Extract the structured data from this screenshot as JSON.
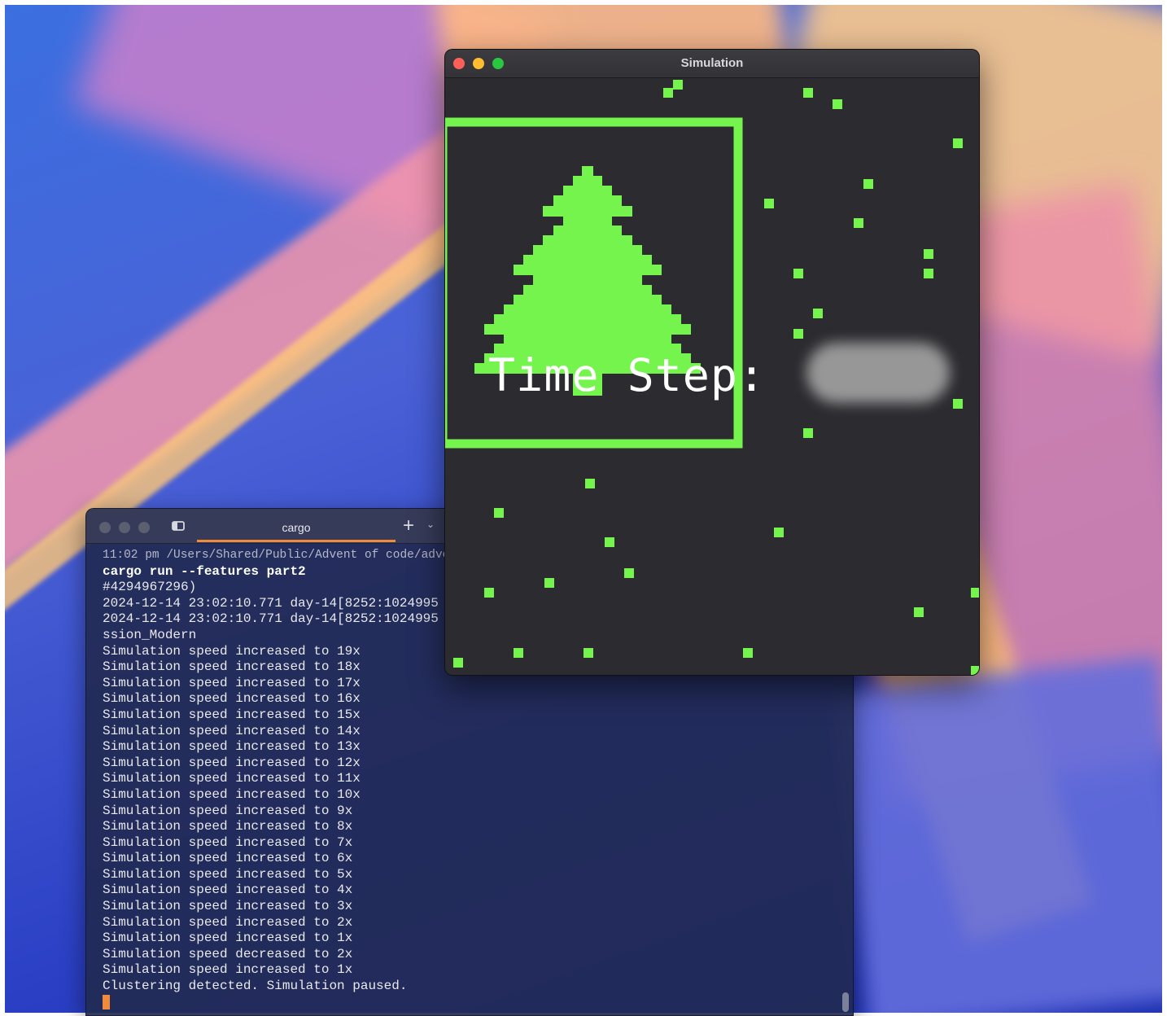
{
  "colors": {
    "robot_green": "#76f44e",
    "sim_background": "#2c2c30",
    "terminal_tab_accent": "#f08a3c"
  },
  "simulation_window": {
    "title": "Simulation",
    "overlay_label": "Time Step:",
    "overlay_value_hidden": true,
    "icons": [
      "close-icon",
      "minimize-icon",
      "zoom-icon"
    ]
  },
  "terminal_window": {
    "tab_title": "cargo",
    "icons": [
      "sidebar-icon",
      "plus-icon",
      "chevron-down-icon"
    ],
    "lines": [
      {
        "kind": "path",
        "text": "11:02 pm /Users/Shared/Public/Advent of code/adve"
      },
      {
        "kind": "cmd",
        "text": "cargo run --features part2"
      },
      {
        "kind": "out",
        "text": "#4294967296)"
      },
      {
        "kind": "out",
        "text": "2024-12-14 23:02:10.771 day-14[8252:1024995"
      },
      {
        "kind": "out",
        "text": "2024-12-14 23:02:10.771 day-14[8252:1024995"
      },
      {
        "kind": "out",
        "text": "ssion_Modern"
      },
      {
        "kind": "out",
        "text": "Simulation speed increased to 19x"
      },
      {
        "kind": "out",
        "text": "Simulation speed increased to 18x"
      },
      {
        "kind": "out",
        "text": "Simulation speed increased to 17x"
      },
      {
        "kind": "out",
        "text": "Simulation speed increased to 16x"
      },
      {
        "kind": "out",
        "text": "Simulation speed increased to 15x"
      },
      {
        "kind": "out",
        "text": "Simulation speed increased to 14x"
      },
      {
        "kind": "out",
        "text": "Simulation speed increased to 13x"
      },
      {
        "kind": "out",
        "text": "Simulation speed increased to 12x"
      },
      {
        "kind": "out",
        "text": "Simulation speed increased to 11x"
      },
      {
        "kind": "out",
        "text": "Simulation speed increased to 10x"
      },
      {
        "kind": "out",
        "text": "Simulation speed increased to 9x"
      },
      {
        "kind": "out",
        "text": "Simulation speed increased to 8x"
      },
      {
        "kind": "out",
        "text": "Simulation speed increased to 7x"
      },
      {
        "kind": "out",
        "text": "Simulation speed increased to 6x"
      },
      {
        "kind": "out",
        "text": "Simulation speed increased to 5x"
      },
      {
        "kind": "out",
        "text": "Simulation speed increased to 4x"
      },
      {
        "kind": "out",
        "text": "Simulation speed increased to 3x"
      },
      {
        "kind": "out",
        "text": "Simulation speed increased to 2x"
      },
      {
        "kind": "out",
        "text": "Simulation speed increased to 1x"
      },
      {
        "kind": "out",
        "text": "Simulation speed decreased to 2x"
      },
      {
        "kind": "out",
        "text": "Simulation speed increased to 1x"
      },
      {
        "kind": "out",
        "text": "Clustering detected. Simulation paused."
      }
    ]
  }
}
